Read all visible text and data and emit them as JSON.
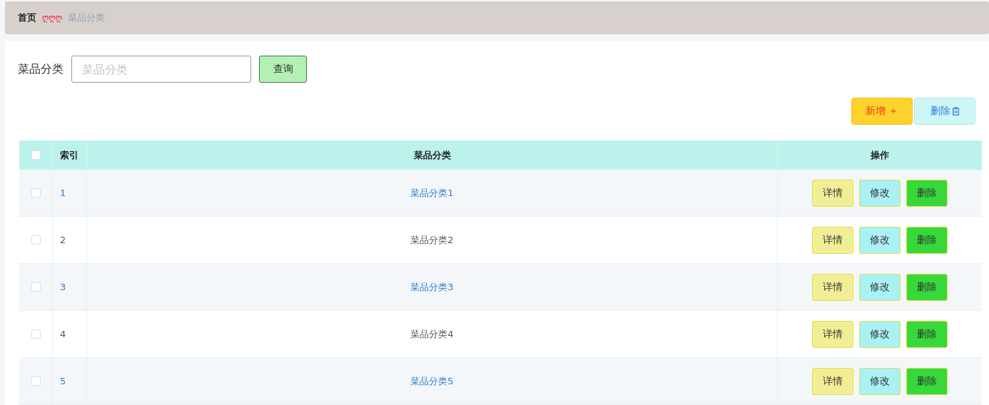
{
  "breadcrumb": {
    "home": "首页",
    "separator": "ღღღ",
    "current": "菜品分类"
  },
  "search": {
    "label": "菜品分类",
    "placeholder": "菜品分类",
    "button": "查询"
  },
  "toolbar": {
    "add": "新增 ＋",
    "delete": "删除"
  },
  "table": {
    "columns": [
      "",
      "索引",
      "菜品分类",
      "操作"
    ],
    "header_checked": false,
    "rows": [
      {
        "checked": false,
        "highlighted": true,
        "index": "1",
        "name": "菜品分类1",
        "actions": [
          "详情",
          "修改",
          "删除"
        ]
      },
      {
        "checked": false,
        "highlighted": false,
        "index": "2",
        "name": "菜品分类2",
        "actions": [
          "详情",
          "修改",
          "删除"
        ]
      },
      {
        "checked": false,
        "highlighted": true,
        "index": "3",
        "name": "菜品分类3",
        "actions": [
          "详情",
          "修改",
          "删除"
        ]
      },
      {
        "checked": false,
        "highlighted": false,
        "index": "4",
        "name": "菜品分类4",
        "actions": [
          "详情",
          "修改",
          "删除"
        ]
      },
      {
        "checked": false,
        "highlighted": true,
        "index": "5",
        "name": "菜品分类5",
        "actions": [
          "详情",
          "修改",
          "删除"
        ]
      }
    ]
  }
}
